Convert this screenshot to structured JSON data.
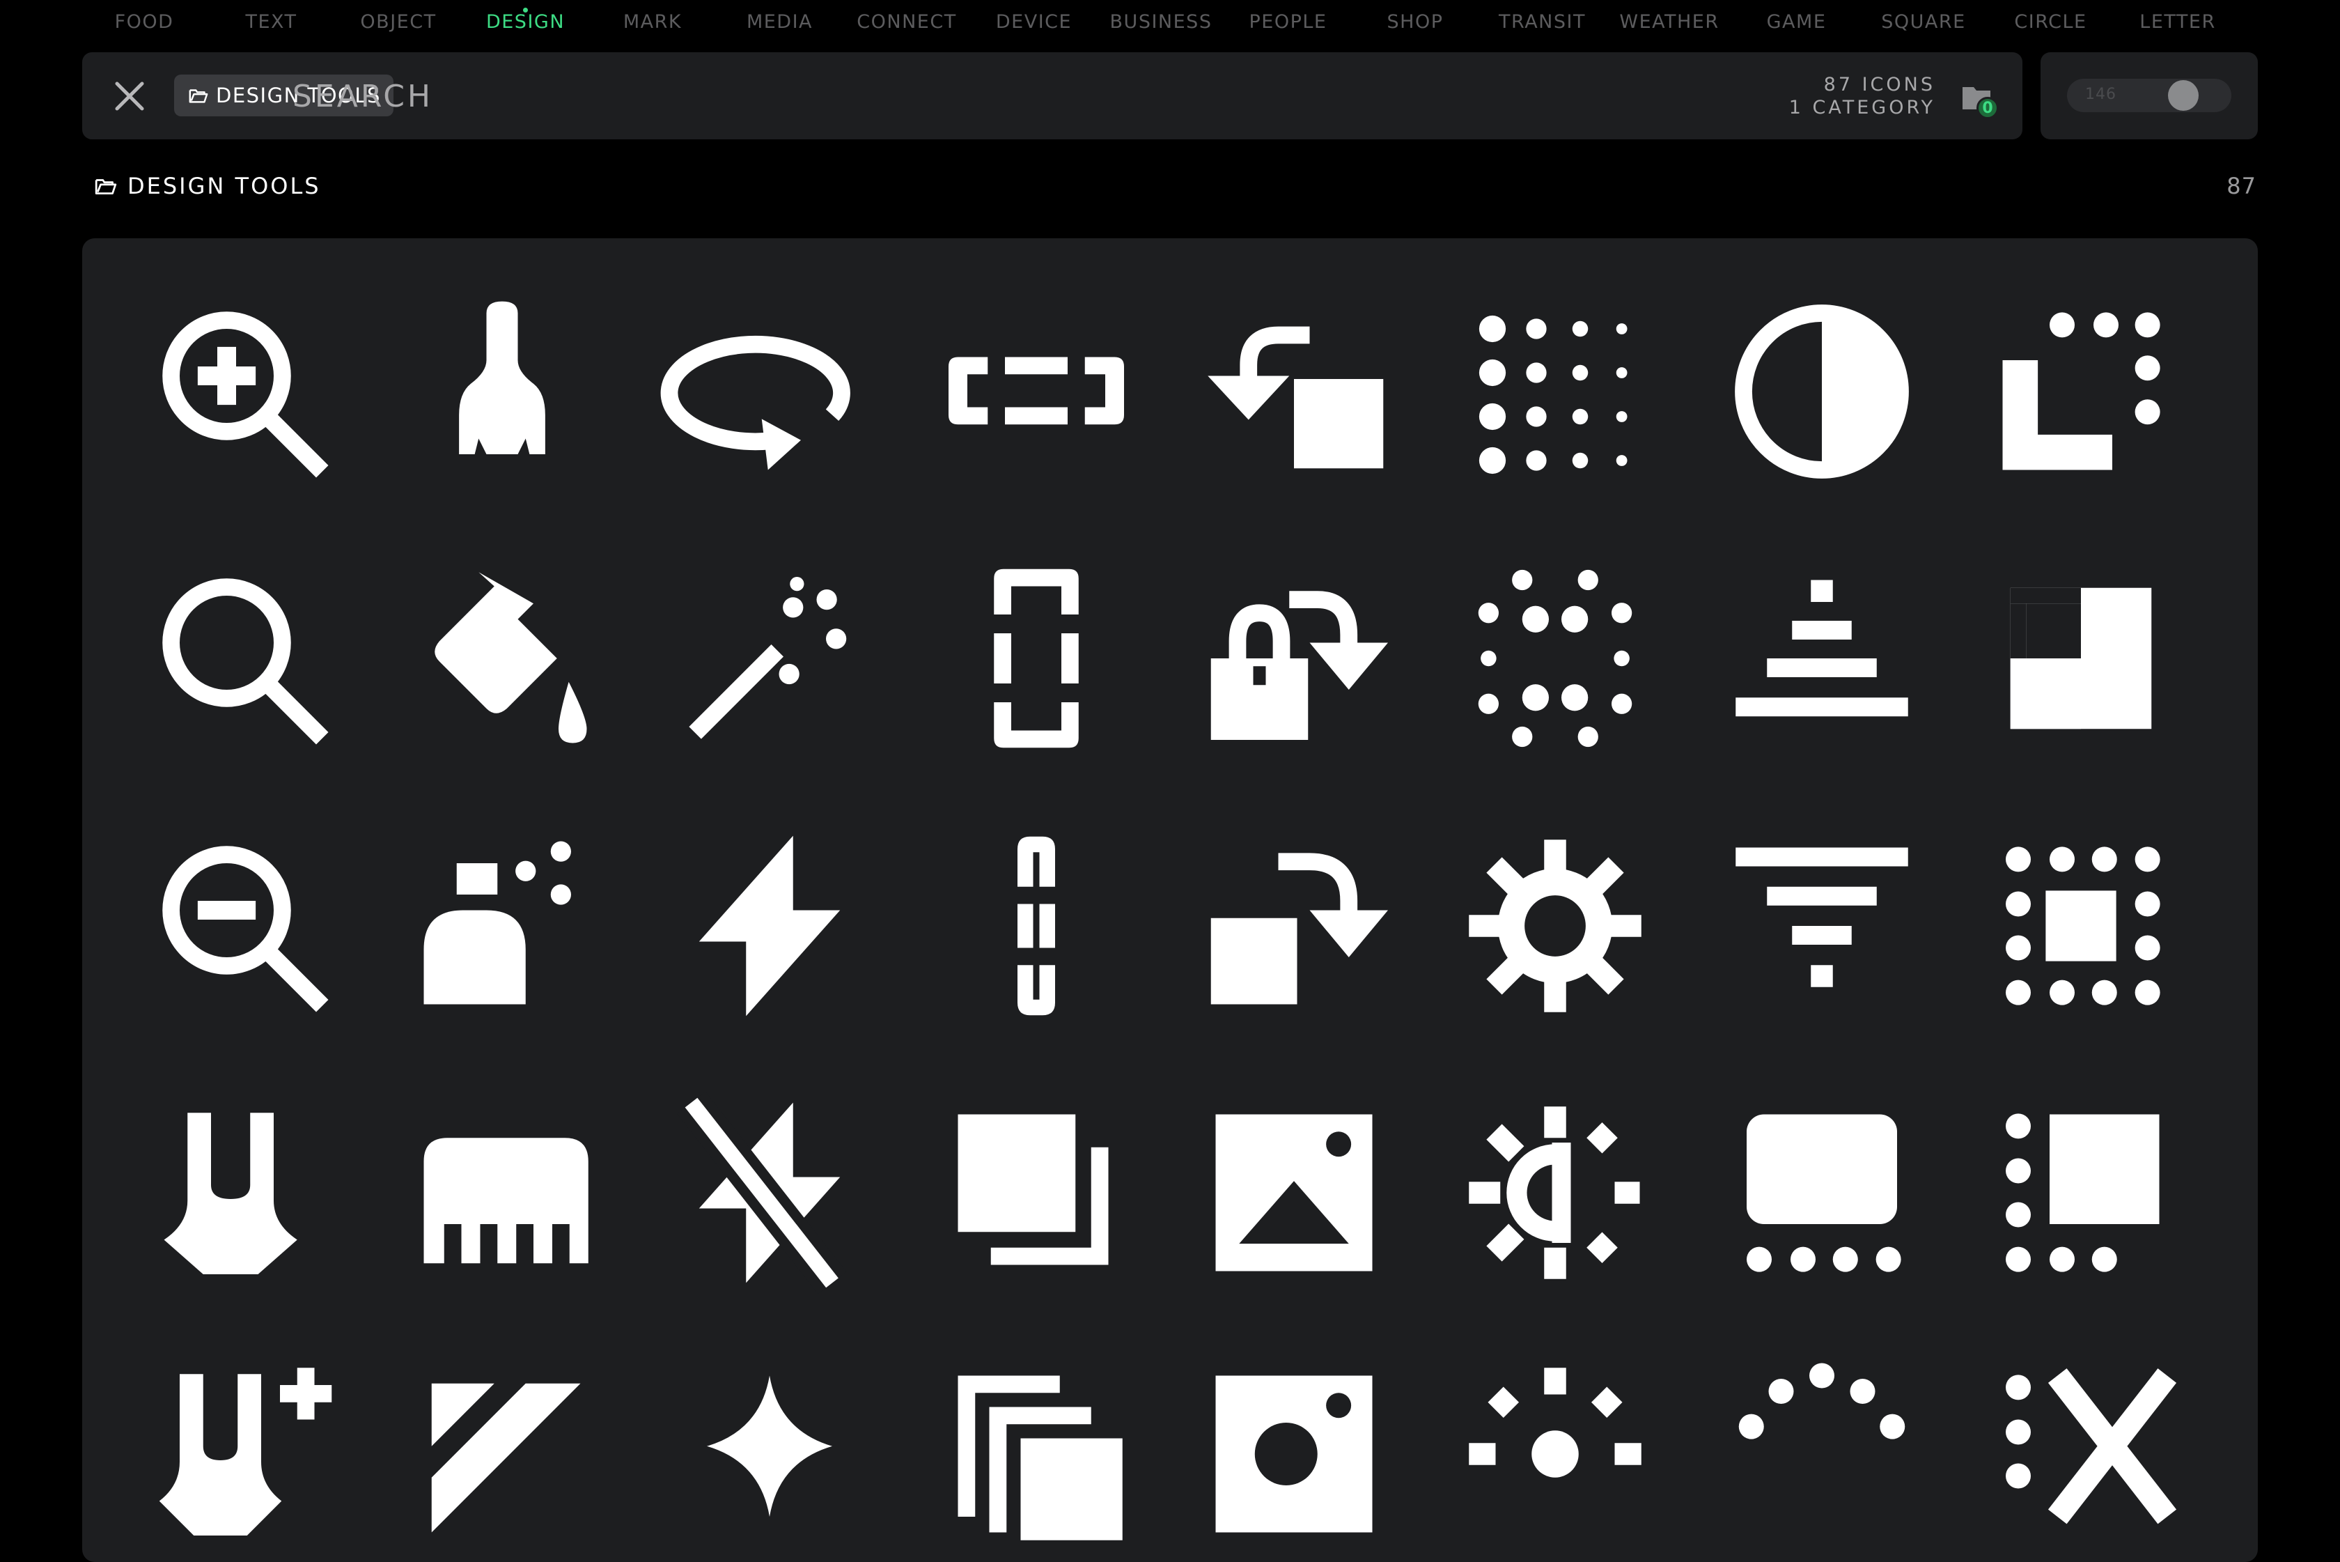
{
  "categories": [
    "FOOD",
    "TEXT",
    "OBJECT",
    "DESIGN",
    "MARK",
    "MEDIA",
    "CONNECT",
    "DEVICE",
    "BUSINESS",
    "PEOPLE",
    "SHOP",
    "TRANSIT",
    "WEATHER",
    "GAME",
    "SQUARE",
    "CIRCLE",
    "LETTER"
  ],
  "active_category": "DESIGN",
  "search": {
    "chip_label": "DESIGN TOOLS",
    "placeholder": "SEARCH",
    "value": "",
    "icons_count": "87 ICONS",
    "category_count": "1 CATEGORY",
    "collection_count": "0"
  },
  "size_slider": {
    "value": "146",
    "level": 0.6
  },
  "section": {
    "title": "DESIGN TOOLS",
    "count": "87"
  },
  "colors": {
    "accent": "#3ddc84",
    "panel": "#1d1e20",
    "background": "#000000"
  },
  "icons": [
    "zoom-in-icon",
    "brush-icon",
    "rotate-3d-icon",
    "select-horizontal-icon",
    "undo-square-icon",
    "dot-grid-icon",
    "contrast-icon",
    "select-corner-icon",
    "search-icon",
    "paint-bucket-icon",
    "magic-wand-icon",
    "select-vertical-icon",
    "lock-rotate-icon",
    "blur-dots-icon",
    "pyramid-levels-icon",
    "checker-square-icon",
    "zoom-out-icon",
    "spray-bottle-icon",
    "flash-icon",
    "link-vertical-icon",
    "redo-square-icon",
    "gear-icon",
    "filter-funnel-icon",
    "square-dot-border-icon",
    "pen-nib-icon",
    "comb-ruler-icon",
    "flash-off-icon",
    "copy-layers-icon",
    "image-icon",
    "brightness-half-icon",
    "frame-dots-icon",
    "square-dots-left-icon",
    "pen-add-icon",
    "eraser-icon",
    "sparkle-icon",
    "stack-layers-icon",
    "image-person-icon",
    "sun-dots-icon",
    "dots-arc-icon",
    "dots-x-icon"
  ]
}
